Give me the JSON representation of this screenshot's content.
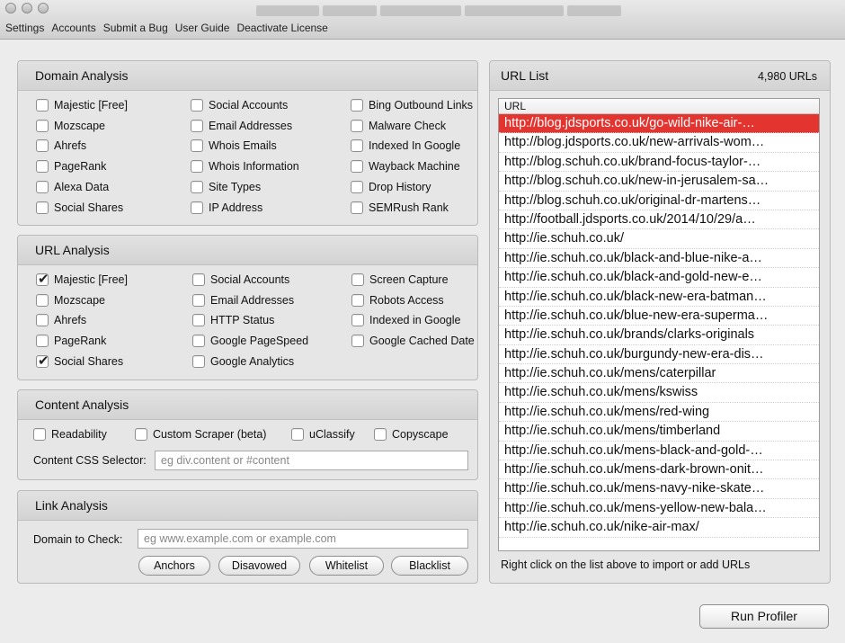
{
  "menu": [
    "Settings",
    "Accounts",
    "Submit a Bug",
    "User Guide",
    "Deactivate License"
  ],
  "domain_analysis": {
    "title": "Domain Analysis",
    "col1": [
      {
        "label": "Majestic [Free]",
        "checked": false
      },
      {
        "label": "Mozscape",
        "checked": false
      },
      {
        "label": "Ahrefs",
        "checked": false
      },
      {
        "label": "PageRank",
        "checked": false
      },
      {
        "label": "Alexa Data",
        "checked": false
      },
      {
        "label": "Social Shares",
        "checked": false
      }
    ],
    "col2": [
      {
        "label": "Social Accounts",
        "checked": false
      },
      {
        "label": "Email Addresses",
        "checked": false
      },
      {
        "label": "Whois Emails",
        "checked": false
      },
      {
        "label": "Whois Information",
        "checked": false
      },
      {
        "label": "Site Types",
        "checked": false
      },
      {
        "label": "IP Address",
        "checked": false
      }
    ],
    "col3": [
      {
        "label": "Bing Outbound Links",
        "checked": false
      },
      {
        "label": "Malware Check",
        "checked": false
      },
      {
        "label": "Indexed In Google",
        "checked": false
      },
      {
        "label": "Wayback Machine",
        "checked": false
      },
      {
        "label": "Drop History",
        "checked": false
      },
      {
        "label": "SEMRush Rank",
        "checked": false
      }
    ]
  },
  "url_analysis": {
    "title": "URL Analysis",
    "col1": [
      {
        "label": "Majestic [Free]",
        "checked": true
      },
      {
        "label": "Mozscape",
        "checked": false
      },
      {
        "label": "Ahrefs",
        "checked": false
      },
      {
        "label": "PageRank",
        "checked": false
      },
      {
        "label": "Social Shares",
        "checked": true
      }
    ],
    "col2": [
      {
        "label": "Social Accounts",
        "checked": false
      },
      {
        "label": "Email Addresses",
        "checked": false
      },
      {
        "label": "HTTP Status",
        "checked": false
      },
      {
        "label": "Google PageSpeed",
        "checked": false
      },
      {
        "label": "Google Analytics",
        "checked": false
      }
    ],
    "col3": [
      {
        "label": "Screen Capture",
        "checked": false
      },
      {
        "label": "Robots Access",
        "checked": false
      },
      {
        "label": "Indexed in Google",
        "checked": false
      },
      {
        "label": "Google Cached Date",
        "checked": false
      }
    ]
  },
  "content_analysis": {
    "title": "Content Analysis",
    "options": [
      {
        "label": "Readability",
        "checked": false
      },
      {
        "label": "Custom Scraper (beta)",
        "checked": false
      },
      {
        "label": "uClassify",
        "checked": false
      },
      {
        "label": "Copyscape",
        "checked": false
      }
    ],
    "selector_label": "Content CSS Selector:",
    "selector_placeholder": "eg div.content or #content"
  },
  "link_analysis": {
    "title": "Link Analysis",
    "domain_label": "Domain to Check:",
    "domain_placeholder": "eg www.example.com or example.com",
    "buttons": [
      "Anchors",
      "Disavowed",
      "Whitelist",
      "Blacklist"
    ]
  },
  "url_list": {
    "title": "URL List",
    "count": "4,980 URLs",
    "column": "URL",
    "hint": "Right click on the list above to import or add URLs",
    "selected_index": 0,
    "rows": [
      "http://blog.jdsports.co.uk/go-wild-nike-air-…",
      "http://blog.jdsports.co.uk/new-arrivals-wom…",
      "http://blog.schuh.co.uk/brand-focus-taylor-…",
      "http://blog.schuh.co.uk/new-in-jerusalem-sa…",
      "http://blog.schuh.co.uk/original-dr-martens…",
      "http://football.jdsports.co.uk/2014/10/29/a…",
      "http://ie.schuh.co.uk/",
      "http://ie.schuh.co.uk/black-and-blue-nike-a…",
      "http://ie.schuh.co.uk/black-and-gold-new-e…",
      "http://ie.schuh.co.uk/black-new-era-batman…",
      "http://ie.schuh.co.uk/blue-new-era-superma…",
      "http://ie.schuh.co.uk/brands/clarks-originals",
      "http://ie.schuh.co.uk/burgundy-new-era-dis…",
      "http://ie.schuh.co.uk/mens/caterpillar",
      "http://ie.schuh.co.uk/mens/kswiss",
      "http://ie.schuh.co.uk/mens/red-wing",
      "http://ie.schuh.co.uk/mens/timberland",
      "http://ie.schuh.co.uk/mens-black-and-gold-…",
      "http://ie.schuh.co.uk/mens-dark-brown-onit…",
      "http://ie.schuh.co.uk/mens-navy-nike-skate…",
      "http://ie.schuh.co.uk/mens-yellow-new-bala…",
      "http://ie.schuh.co.uk/nike-air-max/"
    ]
  },
  "run_button": "Run Profiler",
  "colors": {
    "selected_row": "#e3342f",
    "window_bg": "#ececec"
  }
}
